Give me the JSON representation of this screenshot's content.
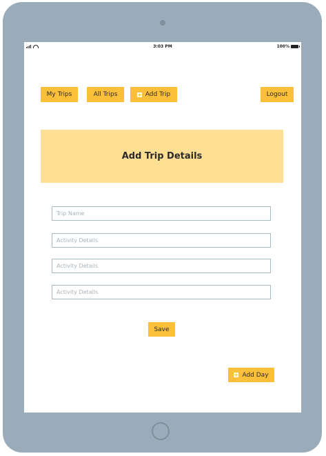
{
  "status_bar": {
    "time": "3:03 PM",
    "battery": "100%"
  },
  "nav": {
    "my_trips": "My Trips",
    "all_trips": "All Trips",
    "add_trip": "Add Trip",
    "logout": "Logout"
  },
  "page_title": "Add Trip Details",
  "form": {
    "trip_name_placeholder": "Trip Name",
    "activity_1_placeholder": "Activity Details",
    "activity_2_placeholder": "Activity Details",
    "activity_3_placeholder": "Activity Details",
    "save_label": "Save",
    "add_day_label": "Add Day"
  },
  "colors": {
    "accent": "#fcbf3a",
    "banner": "#ffdf94",
    "device_frame": "#9aacb9"
  }
}
